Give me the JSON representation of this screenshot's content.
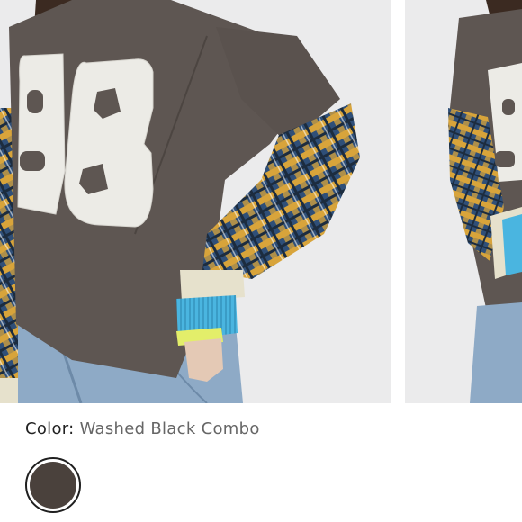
{
  "gallery": {
    "images": [
      {
        "icon": "model-front-photo"
      },
      {
        "icon": "model-side-photo"
      }
    ],
    "number_print": "98"
  },
  "color": {
    "label": "Color:",
    "value": "Washed Black Combo",
    "swatch_hex": "#4a413c"
  },
  "colors": {
    "shirt": "#5e5652",
    "patch": "#ecebe6",
    "plaid_blue": "#2e5a8a",
    "plaid_yellow": "#d9a636",
    "cuff_cream": "#e6e1cc",
    "cuff_blue": "#4ab5e0",
    "denim": "#8eaac6",
    "background": "#ebebec"
  }
}
